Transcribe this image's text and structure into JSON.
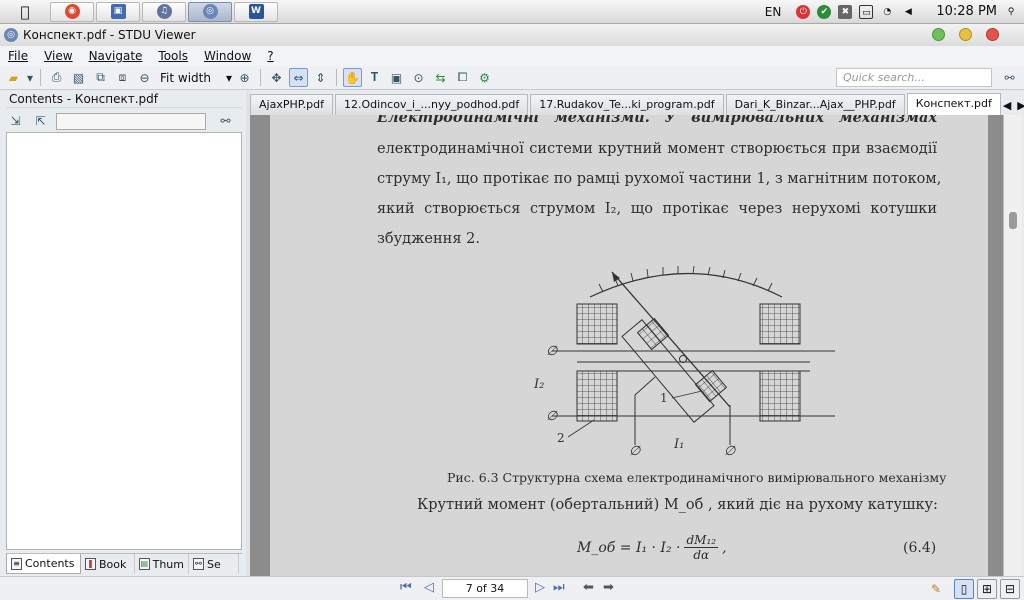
{
  "taskbar": {
    "lang": "EN",
    "time": "10:28 PM",
    "apps": [
      {
        "name": "chrome",
        "glyph": "◉",
        "color": "#e0492c"
      },
      {
        "name": "finder",
        "glyph": "▣",
        "color": "#3e6cb5"
      },
      {
        "name": "itunes",
        "glyph": "♫",
        "color": "#6273a0"
      },
      {
        "name": "stdu",
        "glyph": "◎",
        "color": "#6b86b8"
      },
      {
        "name": "word",
        "glyph": "W",
        "color": "#2a579a"
      }
    ]
  },
  "window": {
    "title": "Конспект.pdf - STDU Viewer"
  },
  "menu": {
    "file": "File",
    "view": "View",
    "navigate": "Navigate",
    "tools": "Tools",
    "window": "Window",
    "help": "?"
  },
  "toolbar": {
    "fit_width": "Fit width",
    "quick_search_placeholder": "Quick search..."
  },
  "sidebar": {
    "title": "Contents - Конспект.pdf",
    "tabs": [
      "Contents",
      "Book",
      "Thum",
      "Se"
    ]
  },
  "tabs": [
    "AjaxPHP.pdf",
    "12.Odincov_i_...nyy_podhod.pdf",
    "17.Rudakov_Te...ki_program.pdf",
    "Dari_K_Binzar...Ajax__PHP.pdf",
    "Конспект.pdf"
  ],
  "doc": {
    "line0": "Електродинамічні механізми. У вимірювальних механізмах",
    "line1": "електродинамічної системи крутний момент створюється при взаємодії",
    "line2": "струму I₁, що протікає по рамці рухомої частини 1, з магнітним потоком,",
    "line3": "який створюється струмом I₂, що протікає через нерухомі котушки",
    "line4": "збудження 2.",
    "fig_i2": "I₂",
    "fig_i1": "I₁",
    "fig_1": "1",
    "fig_2": "2",
    "caption": "Рис. 6.3 Структурна схема електродинамічного вимірювального механізму",
    "para2": "Крутний момент (обертальний) M_об , який діє на рухому катушку:",
    "formula_lhs": "M_об = I₁ · I₂ ·",
    "formula_num": "dM₁₂",
    "formula_den": "dα",
    "formula_tail": ",",
    "eq_no": "(6.4)"
  },
  "statusbar": {
    "page": "7 of 34"
  }
}
